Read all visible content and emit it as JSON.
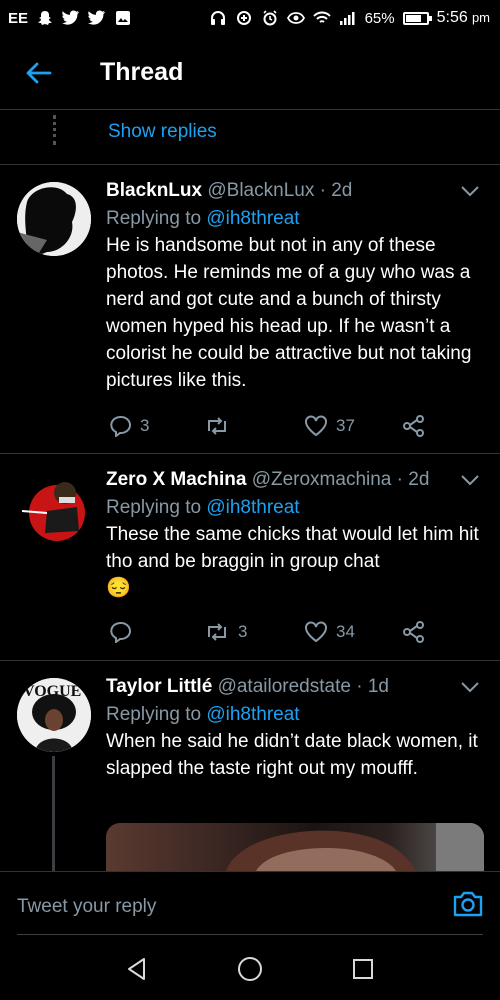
{
  "status_bar": {
    "carrier": "EE",
    "battery": "65%",
    "time": "5:56",
    "time_suffix": "pm",
    "icons": [
      "snapchat-icon",
      "twitter-icon",
      "twitter-icon",
      "gallery-icon",
      "headphones-icon",
      "data-saver-icon",
      "alarm-icon",
      "eye-icon",
      "wifi-icon",
      "signal-icon",
      "battery-icon"
    ]
  },
  "header": {
    "title": "Thread",
    "back_icon": "arrow-left-icon"
  },
  "show_replies": {
    "label": "Show replies"
  },
  "tweets": [
    {
      "name": "BlacknLux",
      "handle": "@BlacknLux",
      "time": "· 2d",
      "replying_prefix": "Replying to ",
      "replying_to": "@ih8threat",
      "text": "He is handsome but not in any of these photos. He reminds me of a guy who was a nerd and got cute and a bunch of thirsty women hyped his head up. If he wasn’t a colorist he could be attractive but not taking pictures like this.",
      "replies": "3",
      "retweets": "",
      "likes": "37"
    },
    {
      "name": "Zero X Machina",
      "handle": "@Zeroxmachina",
      "time": "· 2d",
      "replying_prefix": "Replying to ",
      "replying_to": "@ih8threat",
      "text": "These the same chicks that would let him hit tho and be braggin in group chat",
      "emoji": "😔",
      "replies": "",
      "retweets": "3",
      "likes": "34"
    },
    {
      "name": "Taylor Littlé",
      "handle": "@atailoredstate",
      "time": "· 1d",
      "replying_prefix": "Replying to ",
      "replying_to": "@ih8threat",
      "text": "When he said he didn’t date black women, it slapped the taste right out my moufff.",
      "avatar_text": "VOGUE"
    }
  ],
  "composer": {
    "placeholder": "Tweet your reply",
    "camera_icon": "camera-icon"
  },
  "nav": {
    "icons": [
      "back-triangle-icon",
      "home-circle-icon",
      "recents-square-icon"
    ]
  },
  "colors": {
    "accent": "#1da1f2",
    "background": "#000000",
    "muted": "#8899a6",
    "divider": "#2f3336"
  }
}
